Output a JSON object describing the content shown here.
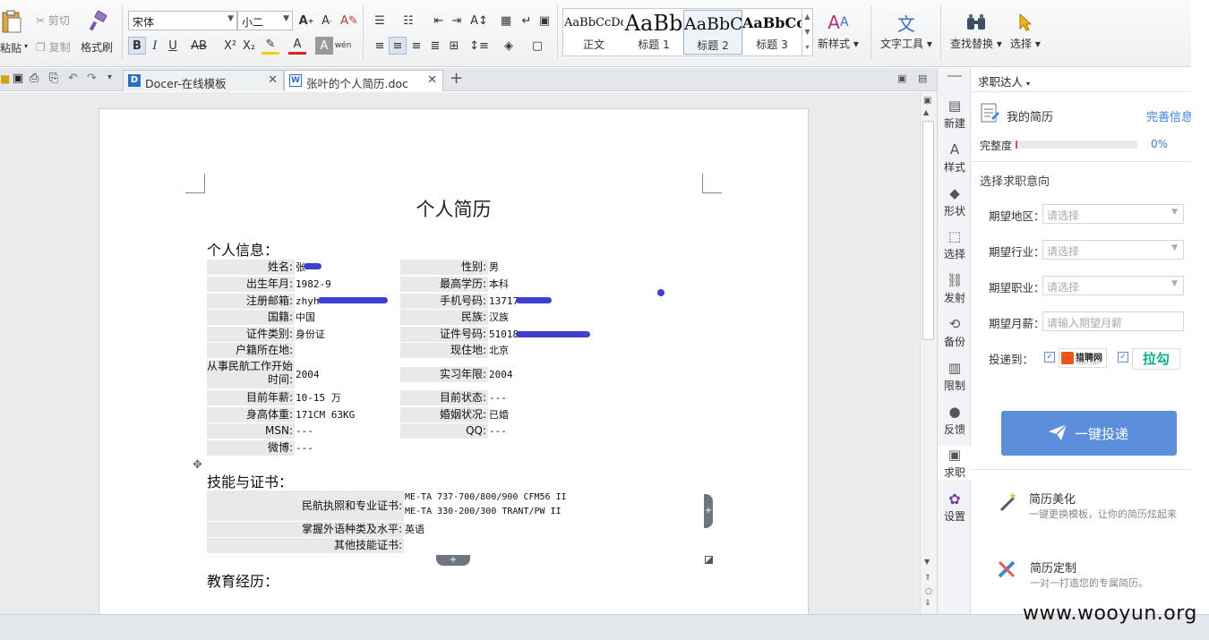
{
  "ribbon": {
    "paste": "粘贴",
    "cut": "剪切",
    "copy": "复制",
    "format_painter": "格式刷",
    "font_name": "宋体",
    "font_size": "小二",
    "styles": [
      {
        "sample": "AaBbCcDd",
        "label": "正文"
      },
      {
        "sample": "AaBb",
        "label": "标题 1"
      },
      {
        "sample": "AaBbC",
        "label": "标题 2"
      },
      {
        "sample": "AaBbCcI",
        "label": "标题 3"
      }
    ],
    "new_style": "新样式",
    "text_tools": "文字工具",
    "find_replace": "查找替换",
    "select": "选择"
  },
  "tabs": [
    {
      "label": "Docer-在线模板",
      "icon": "docer-icon"
    },
    {
      "label": "张叶的个人简历.doc",
      "icon": "word-doc-icon"
    }
  ],
  "document": {
    "title": "个人简历",
    "section_personal": "个人信息：",
    "personal_left": [
      {
        "label": "姓名:",
        "value": "张"
      },
      {
        "label": "出生年月:",
        "value": "1982-9"
      },
      {
        "label": "注册邮箱:",
        "value": "zhyh"
      },
      {
        "label": "国籍:",
        "value": "中国"
      },
      {
        "label": "证件类别:",
        "value": "身份证"
      },
      {
        "label": "户籍所在地:",
        "value": ""
      },
      {
        "label": "从事民航工作开始时间:",
        "value": "2004"
      },
      {
        "label": "目前年薪:",
        "value": "10-15 万"
      },
      {
        "label": "身高体重:",
        "value": "171CM 63KG"
      },
      {
        "label": "MSN:",
        "value": "---"
      },
      {
        "label": "微博:",
        "value": "---"
      }
    ],
    "personal_right": [
      {
        "label": "性别:",
        "value": "男"
      },
      {
        "label": "最高学历:",
        "value": "本科"
      },
      {
        "label": "手机号码:",
        "value": "13717"
      },
      {
        "label": "民族:",
        "value": "汉族"
      },
      {
        "label": "证件号码:",
        "value": "51018"
      },
      {
        "label": "现住地:",
        "value": "北京"
      },
      {
        "label": "实习年限:",
        "value": "2004"
      },
      {
        "label": "目前状态:",
        "value": "---"
      },
      {
        "label": "婚姻状况:",
        "value": "已婚"
      },
      {
        "label": "QQ:",
        "value": "---"
      }
    ],
    "section_skills": "技能与证书：",
    "skills": [
      {
        "label": "民航执照和专业证书:",
        "value1": "ME-TA 737-700/800/900 CFM56 II",
        "value2": "ME-TA 330-200/300 TRANT/PW II"
      },
      {
        "label": "掌握外语种类及水平:",
        "value1": "英语"
      },
      {
        "label": "其他技能证书:",
        "value1": ""
      }
    ],
    "section_education": "教育经历："
  },
  "sidebar_buttons": [
    "新建",
    "样式",
    "形状",
    "选择",
    "发射",
    "备份",
    "限制",
    "反馈",
    "求职",
    "设置"
  ],
  "panel": {
    "header": "求职达人",
    "my_resume": "我的简历",
    "complete_info": "完善信息",
    "completeness_label": "完整度",
    "completeness_value": "0%",
    "completeness_fraction": 0.0,
    "section_intent": "选择求职意向",
    "fields": [
      {
        "label": "期望地区：",
        "placeholder": "请选择",
        "type": "select"
      },
      {
        "label": "期望行业：",
        "placeholder": "请选择",
        "type": "select"
      },
      {
        "label": "期望职业：",
        "placeholder": "请选择",
        "type": "select"
      },
      {
        "label": "期望月薪：",
        "placeholder": "请输入期望月薪",
        "type": "text"
      }
    ],
    "deliver_to": "投递到：",
    "site1_name": "猎聘网",
    "site1_sub": "liepin.com",
    "site2_name": "拉勾",
    "one_click": "一键投递",
    "promo1_title": "简历美化",
    "promo1_desc": "一键更换模板，让你的简历炫起来",
    "promo2_title": "简历定制",
    "promo2_desc": "一对一打造您的专属简历。"
  },
  "watermark": "www.wooyun.org"
}
